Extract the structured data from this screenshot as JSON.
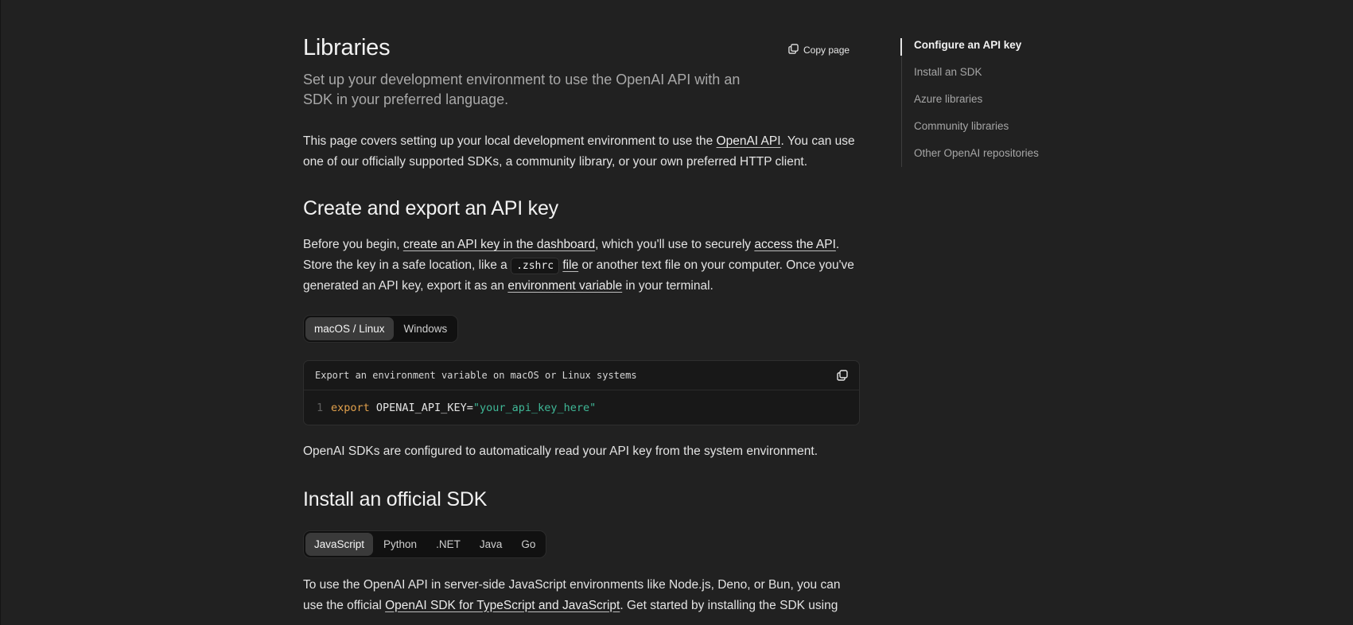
{
  "page": {
    "title": "Libraries",
    "subtitle": "Set up your development environment to use the OpenAI API with an SDK in your preferred language.",
    "copy_page_label": "Copy page"
  },
  "intro": {
    "t1": "This page covers setting up your local development environment to use the ",
    "link": "OpenAI API",
    "t2": ". You can use one of our officially supported SDKs, a community library, or your own preferred HTTP client."
  },
  "section_api_key": {
    "heading": "Create and export an API key",
    "t1": "Before you begin, ",
    "link1": "create an API key in the dashboard",
    "t2": ", which you'll use to securely ",
    "link2": "access the API",
    "t3": ". Store the key in a safe location, like a ",
    "code": ".zshrc",
    "link3": "file",
    "t4": " or another text file on your computer. Once you've generated an API key, export it as an ",
    "link4": "environment variable",
    "t5": " in your terminal.",
    "os_tabs": [
      "macOS / Linux",
      "Windows"
    ],
    "code_block": {
      "caption": "Export an environment variable on macOS or Linux systems",
      "line_number": "1",
      "keyword": "export",
      "variable": " OPENAI_API_KEY=",
      "string": "\"your_api_key_here\""
    },
    "after": "OpenAI SDKs are configured to automatically read your API key from the system environment."
  },
  "section_sdk": {
    "heading": "Install an official SDK",
    "lang_tabs": [
      "JavaScript",
      "Python",
      ".NET",
      "Java",
      "Go"
    ],
    "t1": "To use the OpenAI API in server-side JavaScript environments like Node.js, Deno, or Bun, you can use the official ",
    "link": "OpenAI SDK for TypeScript and JavaScript",
    "t2": ". Get started by installing the SDK using"
  },
  "toc": {
    "items": [
      "Configure an API key",
      "Install an SDK",
      "Azure libraries",
      "Community libraries",
      "Other OpenAI repositories"
    ]
  },
  "icons": {
    "copy_page": "copy-icon",
    "copy_code": "copy-icon"
  },
  "colors": {
    "background": "#212121",
    "code_keyword": "#e2a14c",
    "code_string": "#3fb897"
  }
}
